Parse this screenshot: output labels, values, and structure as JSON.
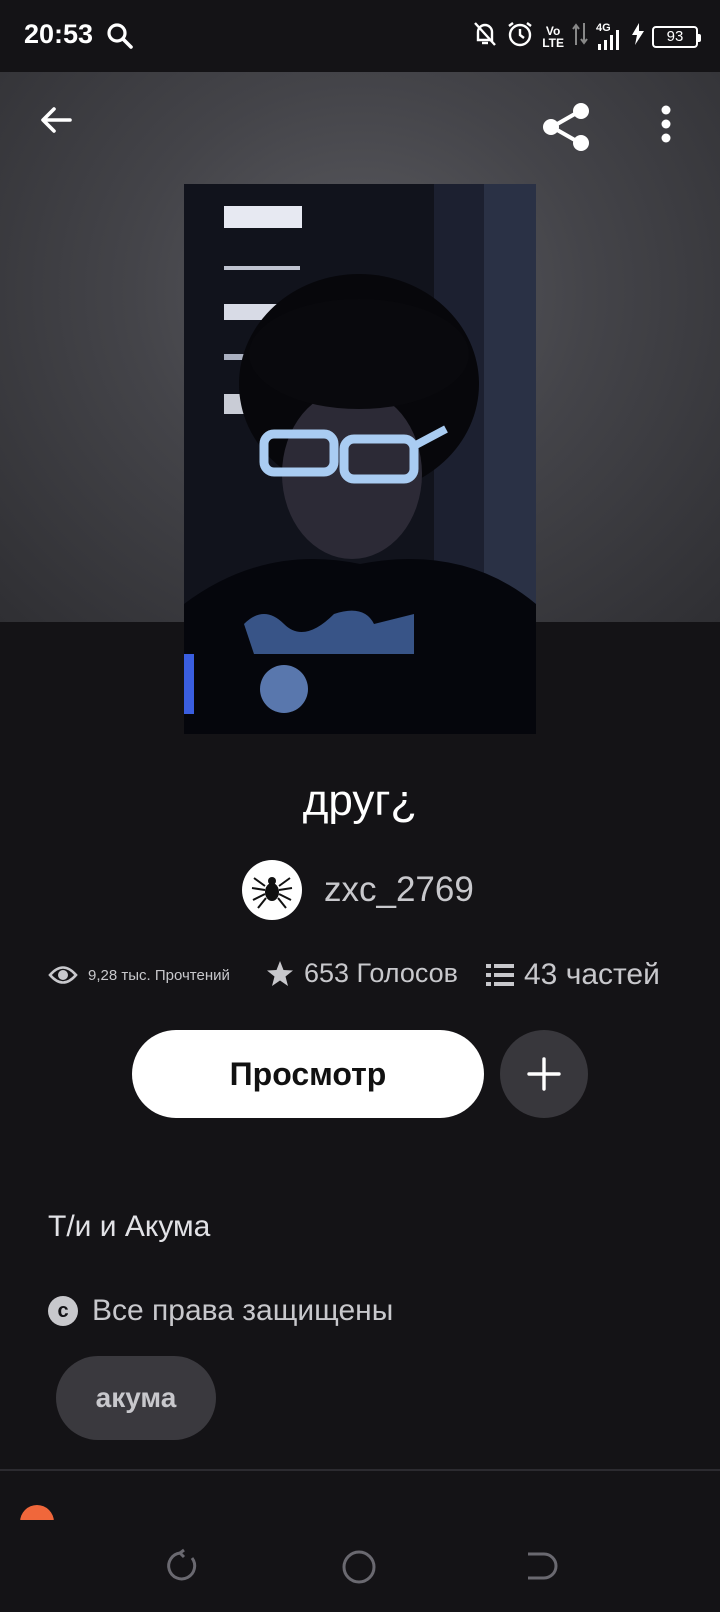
{
  "status_bar": {
    "time": "20:53",
    "volte": "Vo",
    "volte2": "LTE",
    "network": "4G",
    "battery": "93"
  },
  "story": {
    "title": "друг¿",
    "author": "zxc_2769",
    "reads": "9,28 тыс. Прочтений",
    "votes": "653 Голосов",
    "parts": "43 частей",
    "view_button": "Просмотр",
    "description": "Т/и и Акума",
    "rights": "Все права защищены",
    "tag": "акума"
  },
  "colors": {
    "background": "#141316",
    "accent_peek": "#f0673b",
    "secondary_text": "#c8c8cc"
  }
}
